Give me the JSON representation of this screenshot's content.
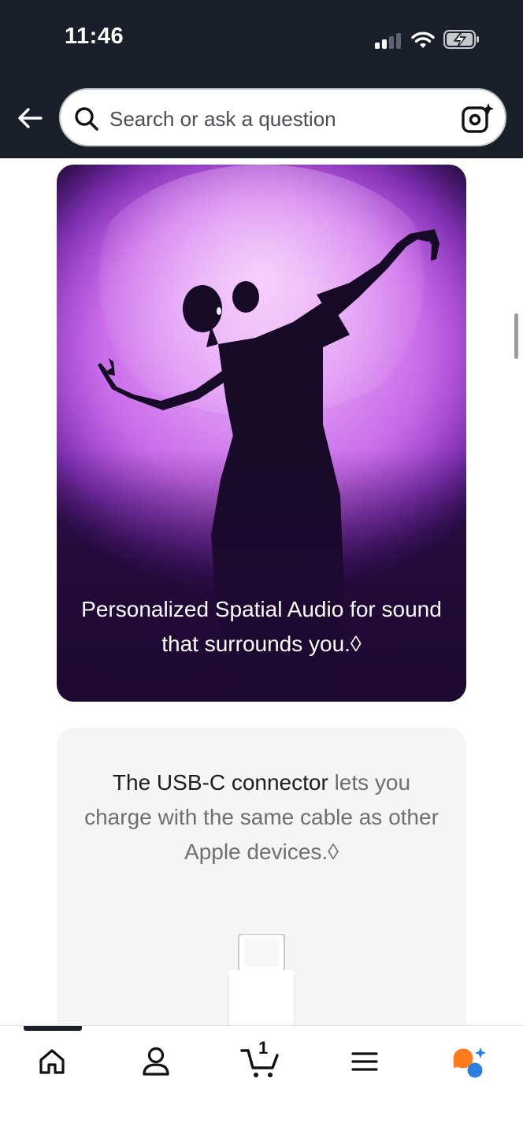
{
  "status_bar": {
    "time": "11:46"
  },
  "search": {
    "placeholder": "Search or ask a question"
  },
  "promo": {
    "caption": "Personalized Spatial Audio for sound that surrounds you.◊"
  },
  "usb_card": {
    "headline_bold": "The USB-C connector",
    "headline_rest": " lets you charge with the same cable as other Apple devices.◊"
  },
  "cart": {
    "count": "1"
  },
  "colors": {
    "header_bg": "#1a2029",
    "promo_purple": "#c86ae8",
    "usb_card_bg": "#f5f5f7",
    "rufus_orange": "#ff7a1a",
    "rufus_blue": "#2a7fe0"
  },
  "icons": {
    "back": "arrow-left-icon",
    "search": "search-icon",
    "lens": "camera-lens-icon",
    "home": "home-icon",
    "account": "person-icon",
    "cart": "cart-icon",
    "menu": "menu-icon",
    "rufus": "rufus-assistant-icon"
  }
}
